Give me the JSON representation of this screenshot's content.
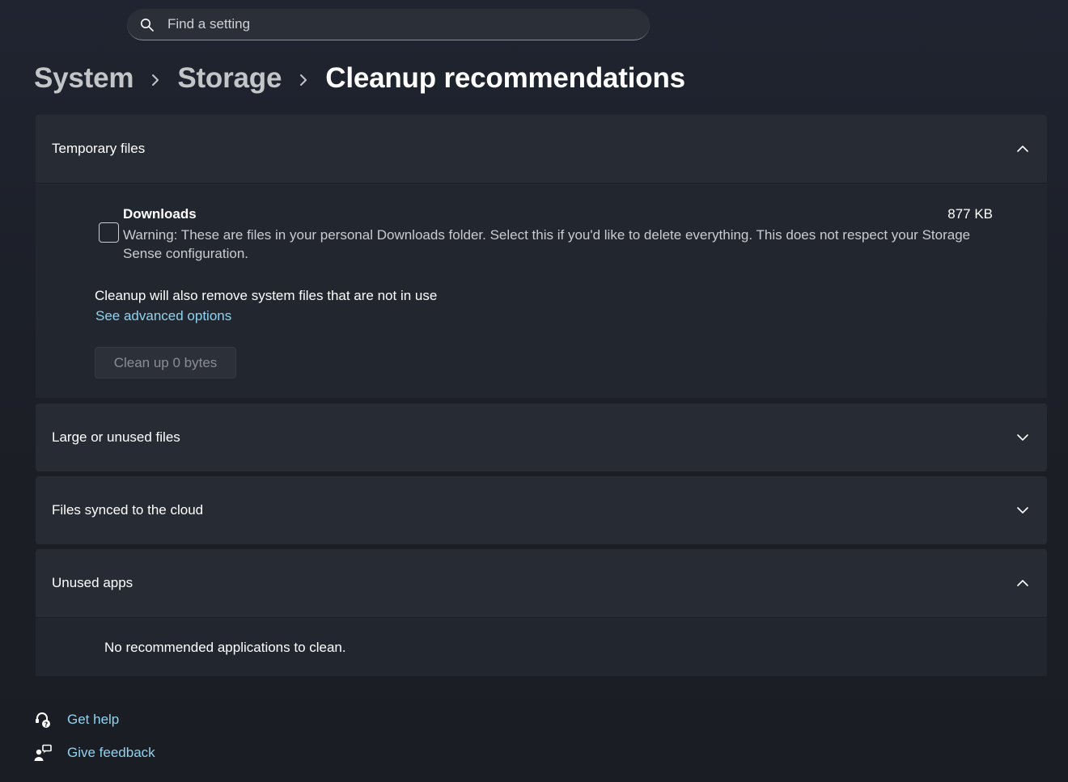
{
  "search": {
    "placeholder": "Find a setting",
    "icon": "search-icon"
  },
  "breadcrumb": {
    "items": [
      "System",
      "Storage"
    ],
    "current": "Cleanup recommendations"
  },
  "sections": {
    "temporary": {
      "title": "Temporary files",
      "expanded": true,
      "downloads": {
        "title": "Downloads",
        "size": "877 KB",
        "checked": false,
        "warning": "Warning: These are files in your personal Downloads folder. Select this if you'd like to delete everything. This does not respect your Storage Sense configuration."
      },
      "system_note": "Cleanup will also remove system files that are not in use",
      "advanced_link": "See advanced options",
      "cleanup_button": "Clean up 0 bytes"
    },
    "large": {
      "title": "Large or unused files",
      "expanded": false
    },
    "cloud": {
      "title": "Files synced to the cloud",
      "expanded": false
    },
    "unused_apps": {
      "title": "Unused apps",
      "expanded": true,
      "message": "No recommended applications to clean."
    }
  },
  "footer": {
    "get_help": "Get help",
    "give_feedback": "Give feedback"
  },
  "colors": {
    "link": "#8fd3f0",
    "panel": "#272b34",
    "panel_body": "#22262e"
  }
}
